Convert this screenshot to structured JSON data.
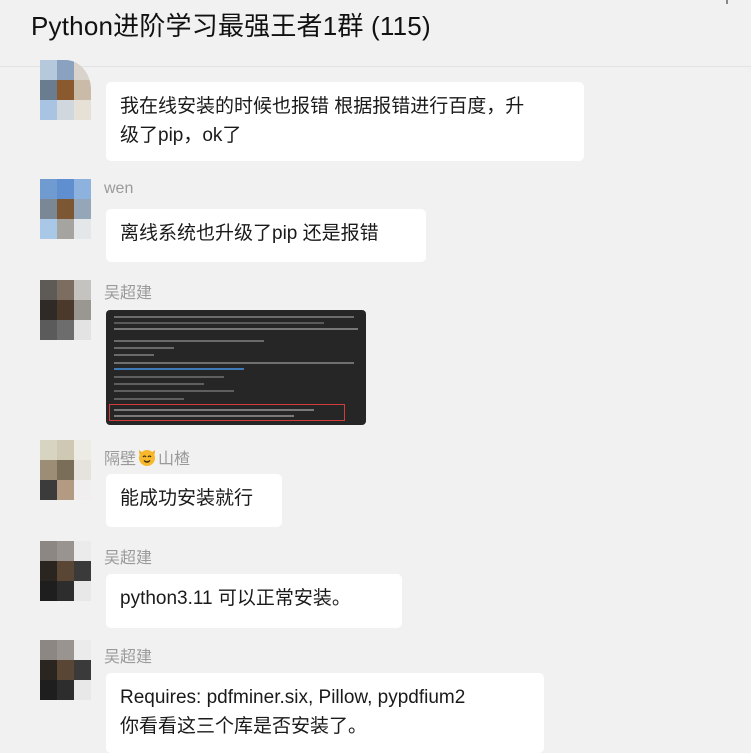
{
  "header": {
    "title": "Python进阶学习最强王者1群 (115)"
  },
  "messages": [
    {
      "sender": "",
      "lines": [
        "我在线安装的时候也报错 根据报错进行百度，升",
        "级了pip，ok了"
      ]
    },
    {
      "sender": "wen",
      "lines": [
        "离线系统也升级了pip 还是报错"
      ]
    },
    {
      "sender": "吴超建",
      "image": "terminal-screenshot"
    },
    {
      "sender_prefix": "隔壁",
      "sender_emoji": "cat-face-emoji",
      "sender_suffix": "山楂",
      "lines": [
        "能成功安装就行"
      ]
    },
    {
      "sender": "吴超建",
      "lines": [
        "python3.11 可以正常安装。"
      ]
    },
    {
      "sender": "吴超建",
      "lines": [
        "Requires: pdfminer.six, Pillow, pypdfium2",
        "你看看这三个库是否安装了。"
      ]
    }
  ],
  "colors": {
    "background": "#f1f1f1",
    "bubble": "#ffffff",
    "sender": "#9a9a9a",
    "highlight_box": "#d23b3b"
  }
}
